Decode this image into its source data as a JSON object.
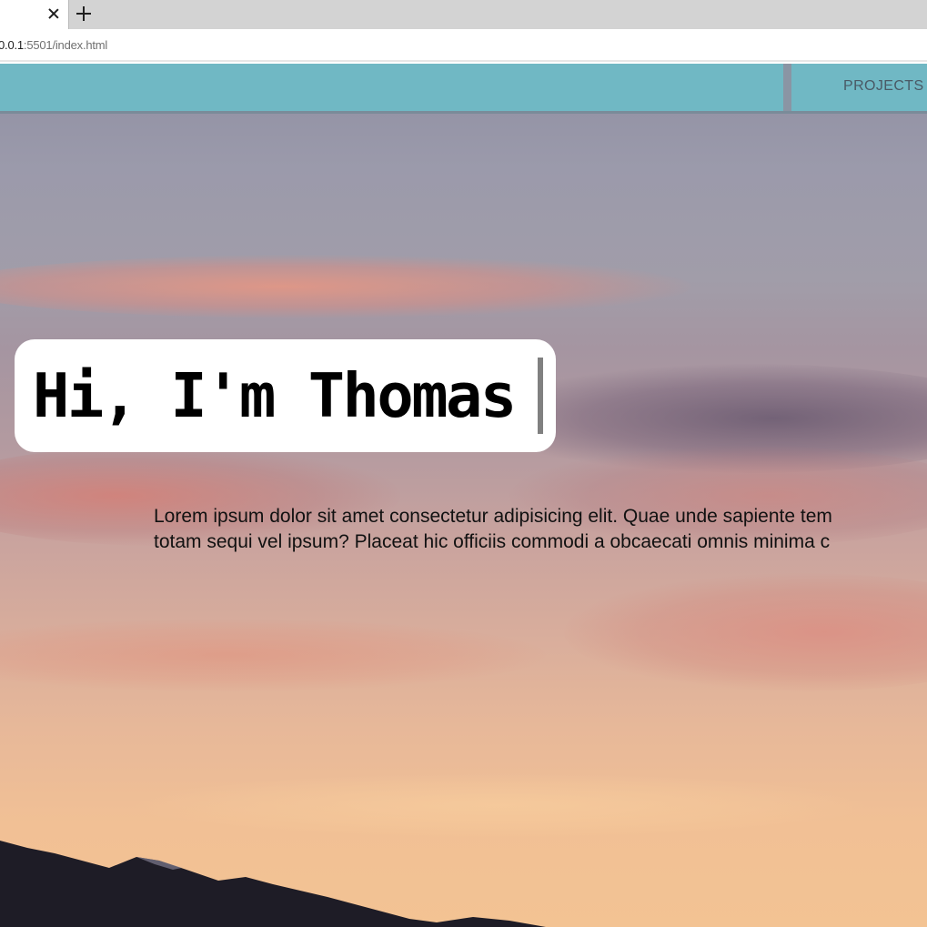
{
  "browser": {
    "url_host": "0.0.1",
    "url_rest": ":5501/index.html"
  },
  "nav": {
    "projects_label": "PROJECTS"
  },
  "hero": {
    "title": "Hi, I'm Thomas"
  },
  "intro": {
    "line1": "Lorem ipsum dolor sit amet consectetur adipisicing elit. Quae unde sapiente tem",
    "line2": "totam sequi vel ipsum? Placeat hic officiis commodi a obcaecati omnis minima c"
  },
  "colors": {
    "navbar": "#70b8c4",
    "navbar_border": "#7a8b99",
    "hero_card": "#ffffff",
    "text": "#000000"
  },
  "icons": [
    "close-icon",
    "plus-icon"
  ]
}
